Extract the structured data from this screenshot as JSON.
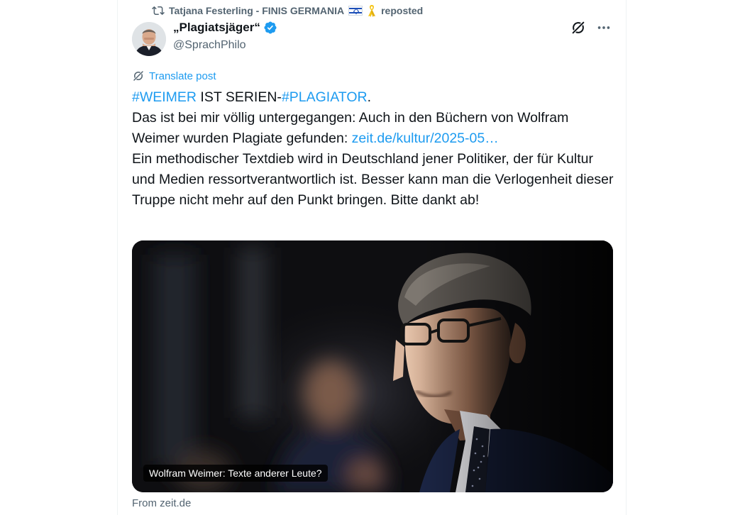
{
  "repost": {
    "reposter_name": "Tatjana Festerling - FINIS GERMANIA",
    "reposted_label": "reposted",
    "icon": "repost-icon"
  },
  "author": {
    "display_name": "„Plagiatsjäger“",
    "handle": "@SprachPhilo",
    "verified": true
  },
  "translate_label": "Translate post",
  "tweet": {
    "line1_hashtag1": "#WEIMER",
    "line1_middle": " IST SERIEN-",
    "line1_hashtag2": "#PLAGIATOR",
    "line1_end": ".",
    "para2_text": "Das ist bei mir völlig untergegangen: Auch in den Büchern von Wolfram Weimer wurden Plagiate gefunden: ",
    "para2_link": "zeit.de/kultur/2025-05…",
    "para3_text": "Ein methodischer Textdieb wird in Deutschland jener Politiker, der für Kultur und Medien ressortverantwortlich ist. Besser kann man die Verlogenheit dieser Truppe nicht mehr auf den Punkt bringen. Bitte dankt ab!"
  },
  "card": {
    "caption": "Wolfram Weimer: Texte anderer Leute?",
    "source": "From zeit.de"
  },
  "colors": {
    "accent": "#1d9bf0",
    "secondary_text": "#536471",
    "primary_text": "#0f1419"
  }
}
